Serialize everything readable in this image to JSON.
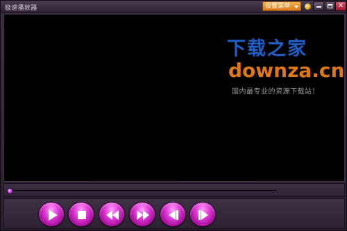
{
  "window": {
    "title": "极速播放器"
  },
  "titlebar": {
    "menu_label": "设置菜单",
    "icons": [
      "skin-icon",
      "minimize-icon",
      "maximize-icon",
      "close-icon"
    ]
  },
  "watermark": {
    "brand_cn": "下载之家",
    "brand_en": "downza.cn",
    "slogan": "国内最专业的资源下载站！"
  },
  "playback": {
    "progress": 0.0
  },
  "controls": {
    "buttons": [
      "play-icon",
      "stop-icon",
      "rewind-icon",
      "fast-forward-icon",
      "previous-frame-icon",
      "next-frame-icon"
    ]
  },
  "colors": {
    "accent": "#e03ad8",
    "menu_button": "#e8952e",
    "watermark_blue": "#1f5fc8",
    "watermark_orange": "#e07815"
  }
}
